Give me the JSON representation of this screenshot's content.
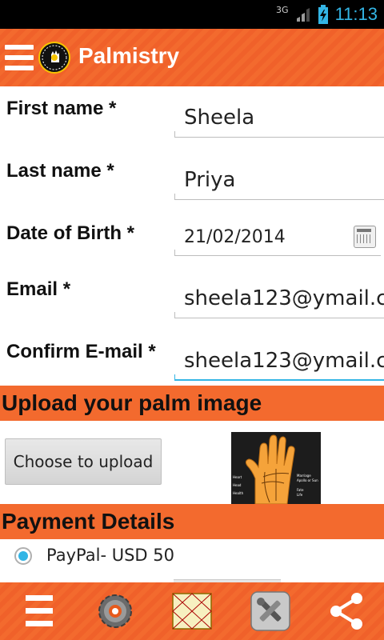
{
  "status_bar": {
    "network_label": "3G",
    "time": "11:13"
  },
  "app_bar": {
    "title": "Palmistry",
    "logo_text": "Palmistry"
  },
  "form": {
    "fields": [
      {
        "label": "First name *",
        "value": "Sheela"
      },
      {
        "label": "Last name *",
        "value": "Priya"
      },
      {
        "label": "Date of Birth *",
        "value": "21/02/2014"
      },
      {
        "label": "Email *",
        "value": "sheela123@ymail.c"
      },
      {
        "label": "Confirm E-mail *",
        "value": "sheela123@ymail.c"
      }
    ]
  },
  "upload": {
    "section_title": "Upload your palm image",
    "button_label": "Choose to upload",
    "palm_labels": [
      "Heart",
      "Head",
      "Health",
      "Marriage",
      "Apollo or Sun",
      "Fate",
      "Life"
    ]
  },
  "payment": {
    "section_title": "Payment Details",
    "options": [
      {
        "label": "PayPal- USD 50",
        "selected": true
      }
    ]
  },
  "bottom_nav": {
    "items": [
      "menu-icon",
      "settings-gear-icon",
      "horoscope-chart-icon",
      "tools-icon",
      "share-icon"
    ]
  },
  "colors": {
    "accent_orange": "#f36a2e",
    "holo_blue": "#33b5e5"
  }
}
